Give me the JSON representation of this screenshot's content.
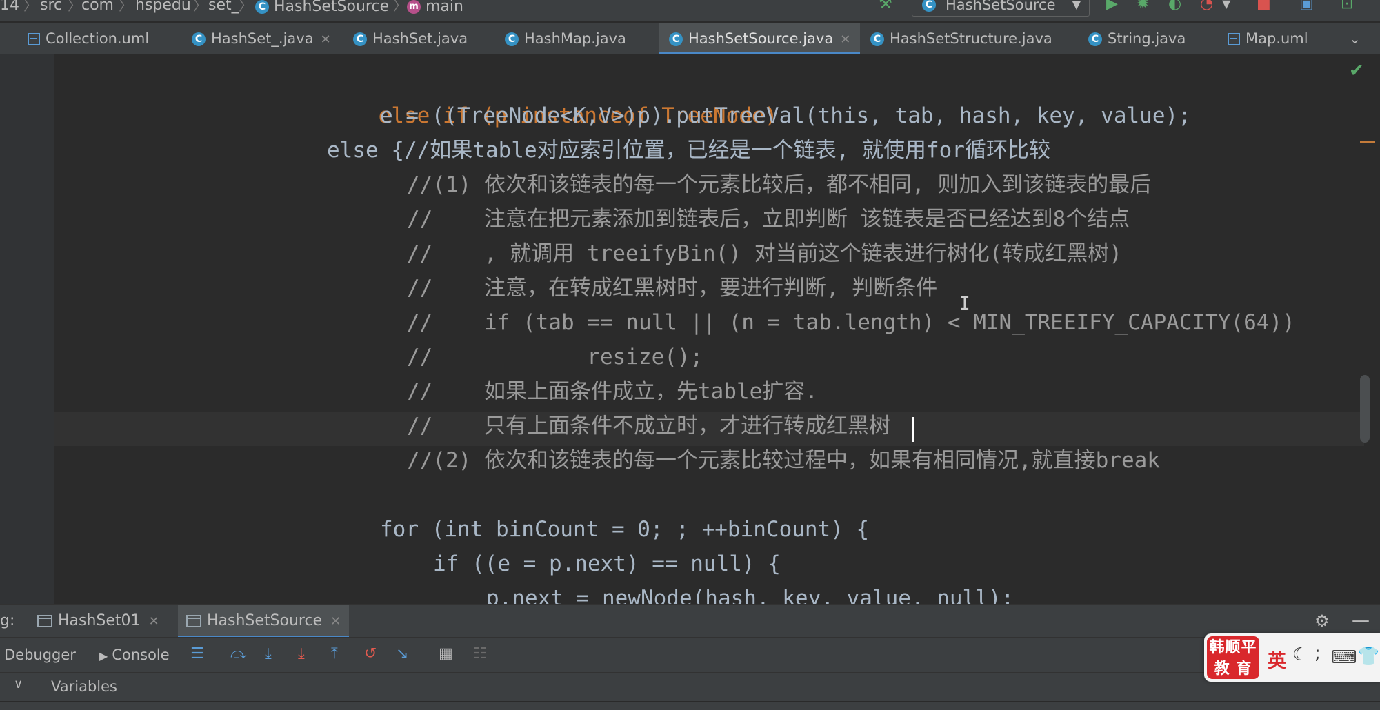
{
  "breadcrumb": [
    "14",
    "src",
    "com",
    "hspedu",
    "set_",
    "HashSetSource",
    "main"
  ],
  "run_config": "HashSetSource",
  "tabs": [
    {
      "label": "Collection.uml",
      "icon": "uml-icon",
      "active": false
    },
    {
      "label": "HashSet_.java",
      "icon": "class-icon",
      "active": false
    },
    {
      "label": "HashSet.java",
      "icon": "class-icon",
      "active": false
    },
    {
      "label": "HashMap.java",
      "icon": "class-icon",
      "active": false
    },
    {
      "label": "HashSetSource.java",
      "icon": "class-icon",
      "active": true
    },
    {
      "label": "HashSetStructure.java",
      "icon": "class-icon",
      "active": false
    },
    {
      "label": "String.java",
      "icon": "class-icon",
      "active": false
    },
    {
      "label": "Map.uml",
      "icon": "uml-icon",
      "active": false
    }
  ],
  "code_lines": [
    "else if (p instanceof TreeNode)",
    "e = ((TreeNode<K,V>)p).putTreeVal(this, tab, hash, key, value);",
    "else {//如果table对应索引位置，已经是一个链表, 就使用for循环比较",
    "//(1) 依次和该链表的每一个元素比较后，都不相同, 则加入到该链表的最后",
    "//    注意在把元素添加到链表后，立即判断 该链表是否已经达到8个结点",
    "//    , 就调用 treeifyBin() 对当前这个链表进行树化(转成红黑树)",
    "//    注意，在转成红黑树时，要进行判断, 判断条件",
    "//    if (tab == null || (n = tab.length) < MIN_TREEIFY_CAPACITY(64))",
    "//            resize();",
    "//    如果上面条件成立，先table扩容.",
    "//    只有上面条件不成立时，才进行转成红黑树",
    "//(2) 依次和该链表的每一个元素比较过程中，如果有相同情况,就直接break",
    "for (int binCount = 0; ; ++binCount) {",
    "if ((e = p.next) == null) {",
    "p.next = newNode(hash, key, value, null);"
  ],
  "debug": {
    "sessions_label": "g:",
    "sessions": [
      {
        "label": "HashSet01",
        "active": false
      },
      {
        "label": "HashSetSource",
        "active": true
      }
    ],
    "debugger_tab": "Debugger",
    "console_tab": "Console",
    "variables_label": "Variables"
  },
  "overlay": {
    "logo_line1": "韩顺平",
    "logo_line2": "教 育",
    "ime_language": "英"
  },
  "colors": {
    "background": "#2b2b2b",
    "comment": "#9a9a9a",
    "keyword": "#cc7832",
    "accent": "#4a88c7",
    "logo_red": "#d9282c"
  }
}
